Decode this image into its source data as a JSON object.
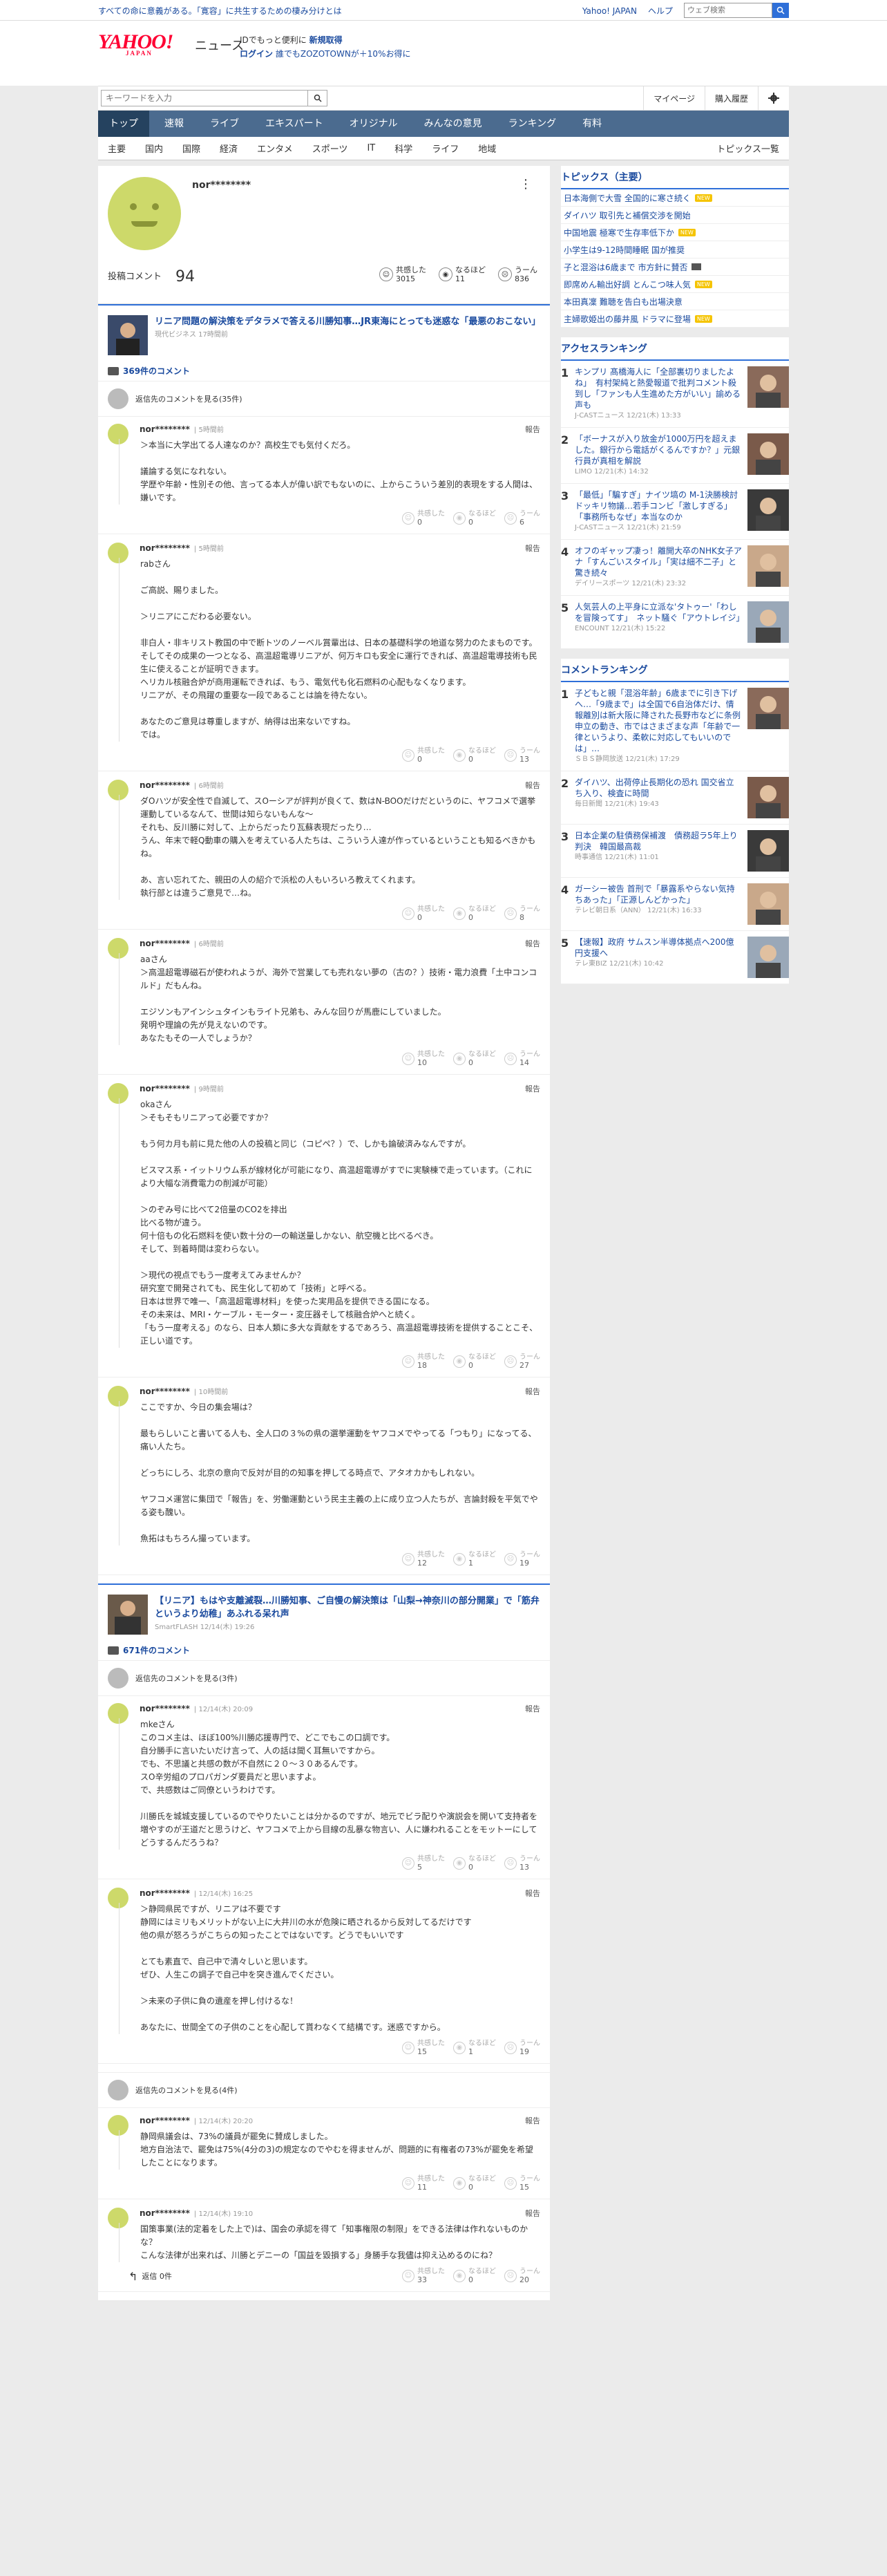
{
  "topbar": {
    "left": "すべての命に意義がある。「寛容」に共生するための棲み分けとは",
    "links": [
      "Yahoo! JAPAN",
      "ヘルプ"
    ],
    "search_placeholder": "ウェブ検索"
  },
  "header": {
    "logo": "YAHOO!",
    "logo_sub": "JAPAN",
    "site": "ニュース",
    "promo1a": "IDでもっと便利に",
    "promo1b": "新規取得",
    "promo2a": "ログイン",
    "promo2b": "誰でもZOZOTOWNが＋10%お得に"
  },
  "search": {
    "placeholder": "キーワードを入力",
    "mypage": "マイページ",
    "history": "購入履歴"
  },
  "gnav": [
    "トップ",
    "速報",
    "ライブ",
    "エキスパート",
    "オリジナル",
    "みんなの意見",
    "ランキング",
    "有料"
  ],
  "subnav": [
    "主要",
    "国内",
    "国際",
    "経済",
    "エンタメ",
    "スポーツ",
    "IT",
    "科学",
    "ライフ",
    "地域"
  ],
  "subnav_right": "トピックス一覧",
  "profile": {
    "name": "nor********",
    "count_label": "投稿コメント",
    "count": "94",
    "s1": "共感した",
    "s1v": "3015",
    "s2": "なるほど",
    "s2v": "11",
    "s3": "うーん",
    "s3v": "836"
  },
  "article1": {
    "title": "リニア問題の解決策をデタラメで答える川勝知事…JR東海にとっても迷惑な「最悪のおこない」",
    "src": "現代ビジネス 17時間前",
    "count": "369件のコメント",
    "prev": "返信先のコメントを見る(35件)"
  },
  "comments1": [
    {
      "name": "nor********",
      "time": "| 5時間前",
      "text": "＞本当に大学出てる人達なのか？高校生でも気付くだろ。\n\n議論する気になれない。\n学歴や年齢・性別その他、言ってる本人が偉い訳でもないのに、上からこういう差別的表現をする人間は、嫌いです。",
      "v": [
        "0",
        "0",
        "6"
      ]
    },
    {
      "name": "nor********",
      "time": "| 5時間前",
      "text": "rabさん\n\nご高説、賜りました。\n\n＞リニアにこだわる必要ない。\n\n非白人・非キリスト教国の中で断トツのノーベル賞輩出は、日本の基礎科学の地道な努力のたまものです。\nそしてその成果の一つとなる、高温超電導リニアが、何万キロも安全に運行できれば、高温超電導技術も民生に使えることが証明できます。\nヘリカル核融合炉が商用運転できれば、もう、電気代も化石燃料の心配もなくなります。\nリニアが、その飛躍の重要な一段であることは論を待たない。\n\nあなたのご意見は尊重しますが、納得は出来ないですね。\nでは。",
      "v": [
        "0",
        "0",
        "13"
      ]
    },
    {
      "name": "nor********",
      "time": "| 6時間前",
      "text": "ダOハツが安全性で自滅して、スOーシアが評判が良くて、数はN-BOOだけだというのに、ヤフコメで選挙運動しているなんて、世間は知らないもんな〜\nそれも、反川勝に対して、上からだったり瓦蘇表現だったり…\nうん、年末で軽Q動車の購入を考えている人たちは、こういう人達が作っているということも知るべきかもね。\n\nあ、言い忘れてた、親田の人の紹介で浜松の人もいろいろ教えてくれます。\n執行部とは違うご意見で…ね。",
      "v": [
        "0",
        "0",
        "8"
      ]
    },
    {
      "name": "nor********",
      "time": "| 6時間前",
      "text": "aaさん\n＞高温超電導磁石が使われようが、海外で営業しても売れない夢の（古の？）技術・電力浪費「土中コンコルド」だもんね。\n\nエジソンもアインシュタインもライト兄弟も、みんな回りが馬鹿にしていました。\n発明や理論の先が見えないのです。\nあなたもその一人でしょうか？",
      "v": [
        "10",
        "0",
        "14"
      ]
    },
    {
      "name": "nor********",
      "time": "| 9時間前",
      "text": "okaさん\n＞そもそもリニアって必要ですか？\n\nもう何カ月も前に見た他の人の投稿と同じ（コピペ？）で、しかも論破済みなんですが。\n\nビスマス系・イットリウム系が線材化が可能になり、高温超電導がすでに実験棟で走っています。（これにより大幅な消費電力の削減が可能）\n\n＞のぞみ号に比べて2倍量のCO2を排出\n比べる物が違う。\n何十倍もの化石燃料を使い数十分の一の輸送量しかない、航空機と比べるべき。\nそして、到着時間は変わらない。\n\n＞現代の視点でもう一度考えてみませんか？\n研究室で開発されても、民生化して初めて「技術」と呼べる。\n日本は世界で唯一、「高温超電導材料」を使った実用品を提供できる国になる。\nその未来は、MRI・ケーブル・モーター・変圧器そして核融合炉へと続く。\n「もう一度考える」のなら、日本人類に多大な貢献をするであろう、高温超電導技術を提供することこそ、正しい道です。",
      "v": [
        "18",
        "0",
        "27"
      ]
    },
    {
      "name": "nor********",
      "time": "| 10時間前",
      "text": "ここですか、今日の集会場は？\n\n最もらしいこと書いてる人も、全人口の３%の県の選挙運動をヤフコメでやってる「つもり」になってる、痛い人たち。\n\nどっちにしろ、北京の意向で反対が目的の知事を押してる時点で、アタオカかもしれない。\n\nヤフコメ運営に集団で「報告」を、労働運動という民主主義の上に成り立つ人たちが、言論封殺を平気でやる姿も醜い。\n\n魚拓はもちろん撮っています。",
      "v": [
        "12",
        "1",
        "19"
      ]
    }
  ],
  "article2": {
    "title": "【リニア】もはや支離滅裂…川勝知事、ご自慢の解決策は「山梨→神奈川の部分開業」で「筋弁というより幼稚」あふれる呆れ声",
    "src": "SmartFLASH 12/14(木) 19:26",
    "count": "671件のコメント",
    "prev": "返信先のコメントを見る(3件)",
    "prev2": "返信先のコメントを見る(4件)"
  },
  "comments2": [
    {
      "name": "nor********",
      "time": "| 12/14(木) 20:09",
      "text": "mkeさん\nこのコメ主は、ほぼ100%川勝応援専門で、どこでもこの口調です。\n自分勝手に言いたいだけ言って、人の話は聞く耳無いですから。\nでも、不思議と共感の数が不自然に２０〜３０あるんです。\nスO辛労組のプロパガンダ要員だと思いますよ。\nで、共感数はご同僚というわけです。\n\n川勝氏を城城支援しているのでやりたいことは分かるのですが、地元でビラ配りや演説会を開いて支持者を増やすのが王道だと思うけど、ヤフコメで上から目線の乱暴な物言い、人に嫌われることをモットーにしてどうするんだろうね？",
      "v": [
        "5",
        "0",
        "13"
      ]
    },
    {
      "name": "nor********",
      "time": "| 12/14(木) 16:25",
      "text": "＞静岡県民ですが、リニアは不要です\n静岡にはミリもメリットがない上に大井川の水が危険に晒されるから反対してるだけです\n他の県が怒ろうがこちらの知ったことではないです。どうでもいいです\n\nとても素直で、自己中で清々しいと思います。\nぜひ、人生この調子で自己中を突き進んでください。\n\n＞未来の子供に負の遺産を押し付けるな！\n\nあなたに、世間全ての子供のことを心配して貰わなくて結構です。迷惑ですから。",
      "v": [
        "15",
        "1",
        "19"
      ]
    },
    {
      "name": "nor********",
      "time": "| 12/14(木) 20:20",
      "text": "静岡県議会は、73%の議員が罷免に賛成しました。\n地方自治法で、罷免は75%(4分の3)の規定なのでやむを得ませんが、問題的に有権者の73%が罷免を希望したことになります。",
      "v": [
        "11",
        "0",
        "15"
      ]
    },
    {
      "name": "nor********",
      "time": "| 12/14(木) 19:10",
      "text": "国策事業(法的定着をした上で)は、国会の承認を得て「知事権限の制限」をできる法律は作れないものかな？\nこんな法律が出来れば、川勝とデニーの「国益を毀損する」身勝手な我儘は抑え込めるのにね？",
      "v": [
        "33",
        "0",
        "20"
      ],
      "replies": "返信 0件"
    }
  ],
  "topics": {
    "title": "トピックス（主要）",
    "items": [
      {
        "t": "日本海側で大雪 全国的に寒さ続く",
        "b": "new"
      },
      {
        "t": "ダイハツ 取引先と補償交渉を開始",
        "b": ""
      },
      {
        "t": "中国地震 極寒で生存率低下か",
        "b": "new"
      },
      {
        "t": "小学生は9-12時間睡眠 国が推奨",
        "b": ""
      },
      {
        "t": "子と混浴は6歳まで 市方針に賛否",
        "b": "video"
      },
      {
        "t": "即席めん輸出好調 とんこつ味人気",
        "b": "new"
      },
      {
        "t": "本田真凜 難聴を告白も出場決意",
        "b": ""
      },
      {
        "t": "主婦歌姫出の藤井風 ドラマに登場",
        "b": "new"
      }
    ]
  },
  "access": {
    "title": "アクセスランキング",
    "items": [
      {
        "n": "1",
        "t": "キンプリ 髙橋海人に「全部裏切りましたよね」　有村架純と熱愛報道で批判コメント殺到し「ファンも人生進めた方がいい」諭める声も",
        "s": "J-CASTニュース 12/21(木) 13:33"
      },
      {
        "n": "2",
        "t": "「ボーナスが入り放金が1000万円を超えました。銀行から電話がくるんですか？」元銀行員が真相を解説",
        "s": "LIMO 12/21(木) 14:32"
      },
      {
        "n": "3",
        "t": "「最低」「騙すぎ」ナイツ塙の M-1決勝検討ドッキリ物議…若手コンビ「激しすぎる」「事務所もなぜ」本当なのか",
        "s": "J-CASTニュース 12/21(木) 21:59"
      },
      {
        "n": "4",
        "t": "オフのギャップ凄っ！離開大卒のNHK女子アナ「すんごいスタイル」「実は細不二子」と驚き続々",
        "s": "デイリースポーツ 12/21(木) 23:32"
      },
      {
        "n": "5",
        "t": "人気芸人の上平身に立派な'タトゥー'「わしを冒険ってす」　ネット騒ぐ「アウトレイジ」",
        "s": "ENCOUNT 12/21(木) 15:22"
      }
    ]
  },
  "comrank": {
    "title": "コメントランキング",
    "items": [
      {
        "n": "1",
        "t": "子どもと親「混浴年齢」6歳までに引き下げへ…「9歳まで」は全国で6自治体だけ、情報離別は新大阪に降された長野市などに条例申立の動き、市ではさまざまな声「年齢で一律というより、柔軟に対応してもいいのでは」…",
        "s": "ＳＢＳ静岡放送 12/21(木) 17:29"
      },
      {
        "n": "2",
        "t": "ダイハツ、出荷停止長期化の恐れ 国交省立ち入り、検査に時間",
        "s": "毎日新聞 12/21(木) 19:43"
      },
      {
        "n": "3",
        "t": "日本企業の駐債務保補渡　債務超ラ5年上り判決　韓国最高裁",
        "s": "時事通信 12/21(木) 11:01"
      },
      {
        "n": "4",
        "t": "ガーシー被告 首刑で「暴露系やらない気持ちあった」「正源しんどかった」",
        "s": "テレビ朝日系（ANN） 12/21(木) 16:33"
      },
      {
        "n": "5",
        "t": "【速報】政府 サムスン半導体拠点へ200億円支援へ",
        "s": "テレ東BIZ 12/21(木) 10:42"
      }
    ]
  }
}
